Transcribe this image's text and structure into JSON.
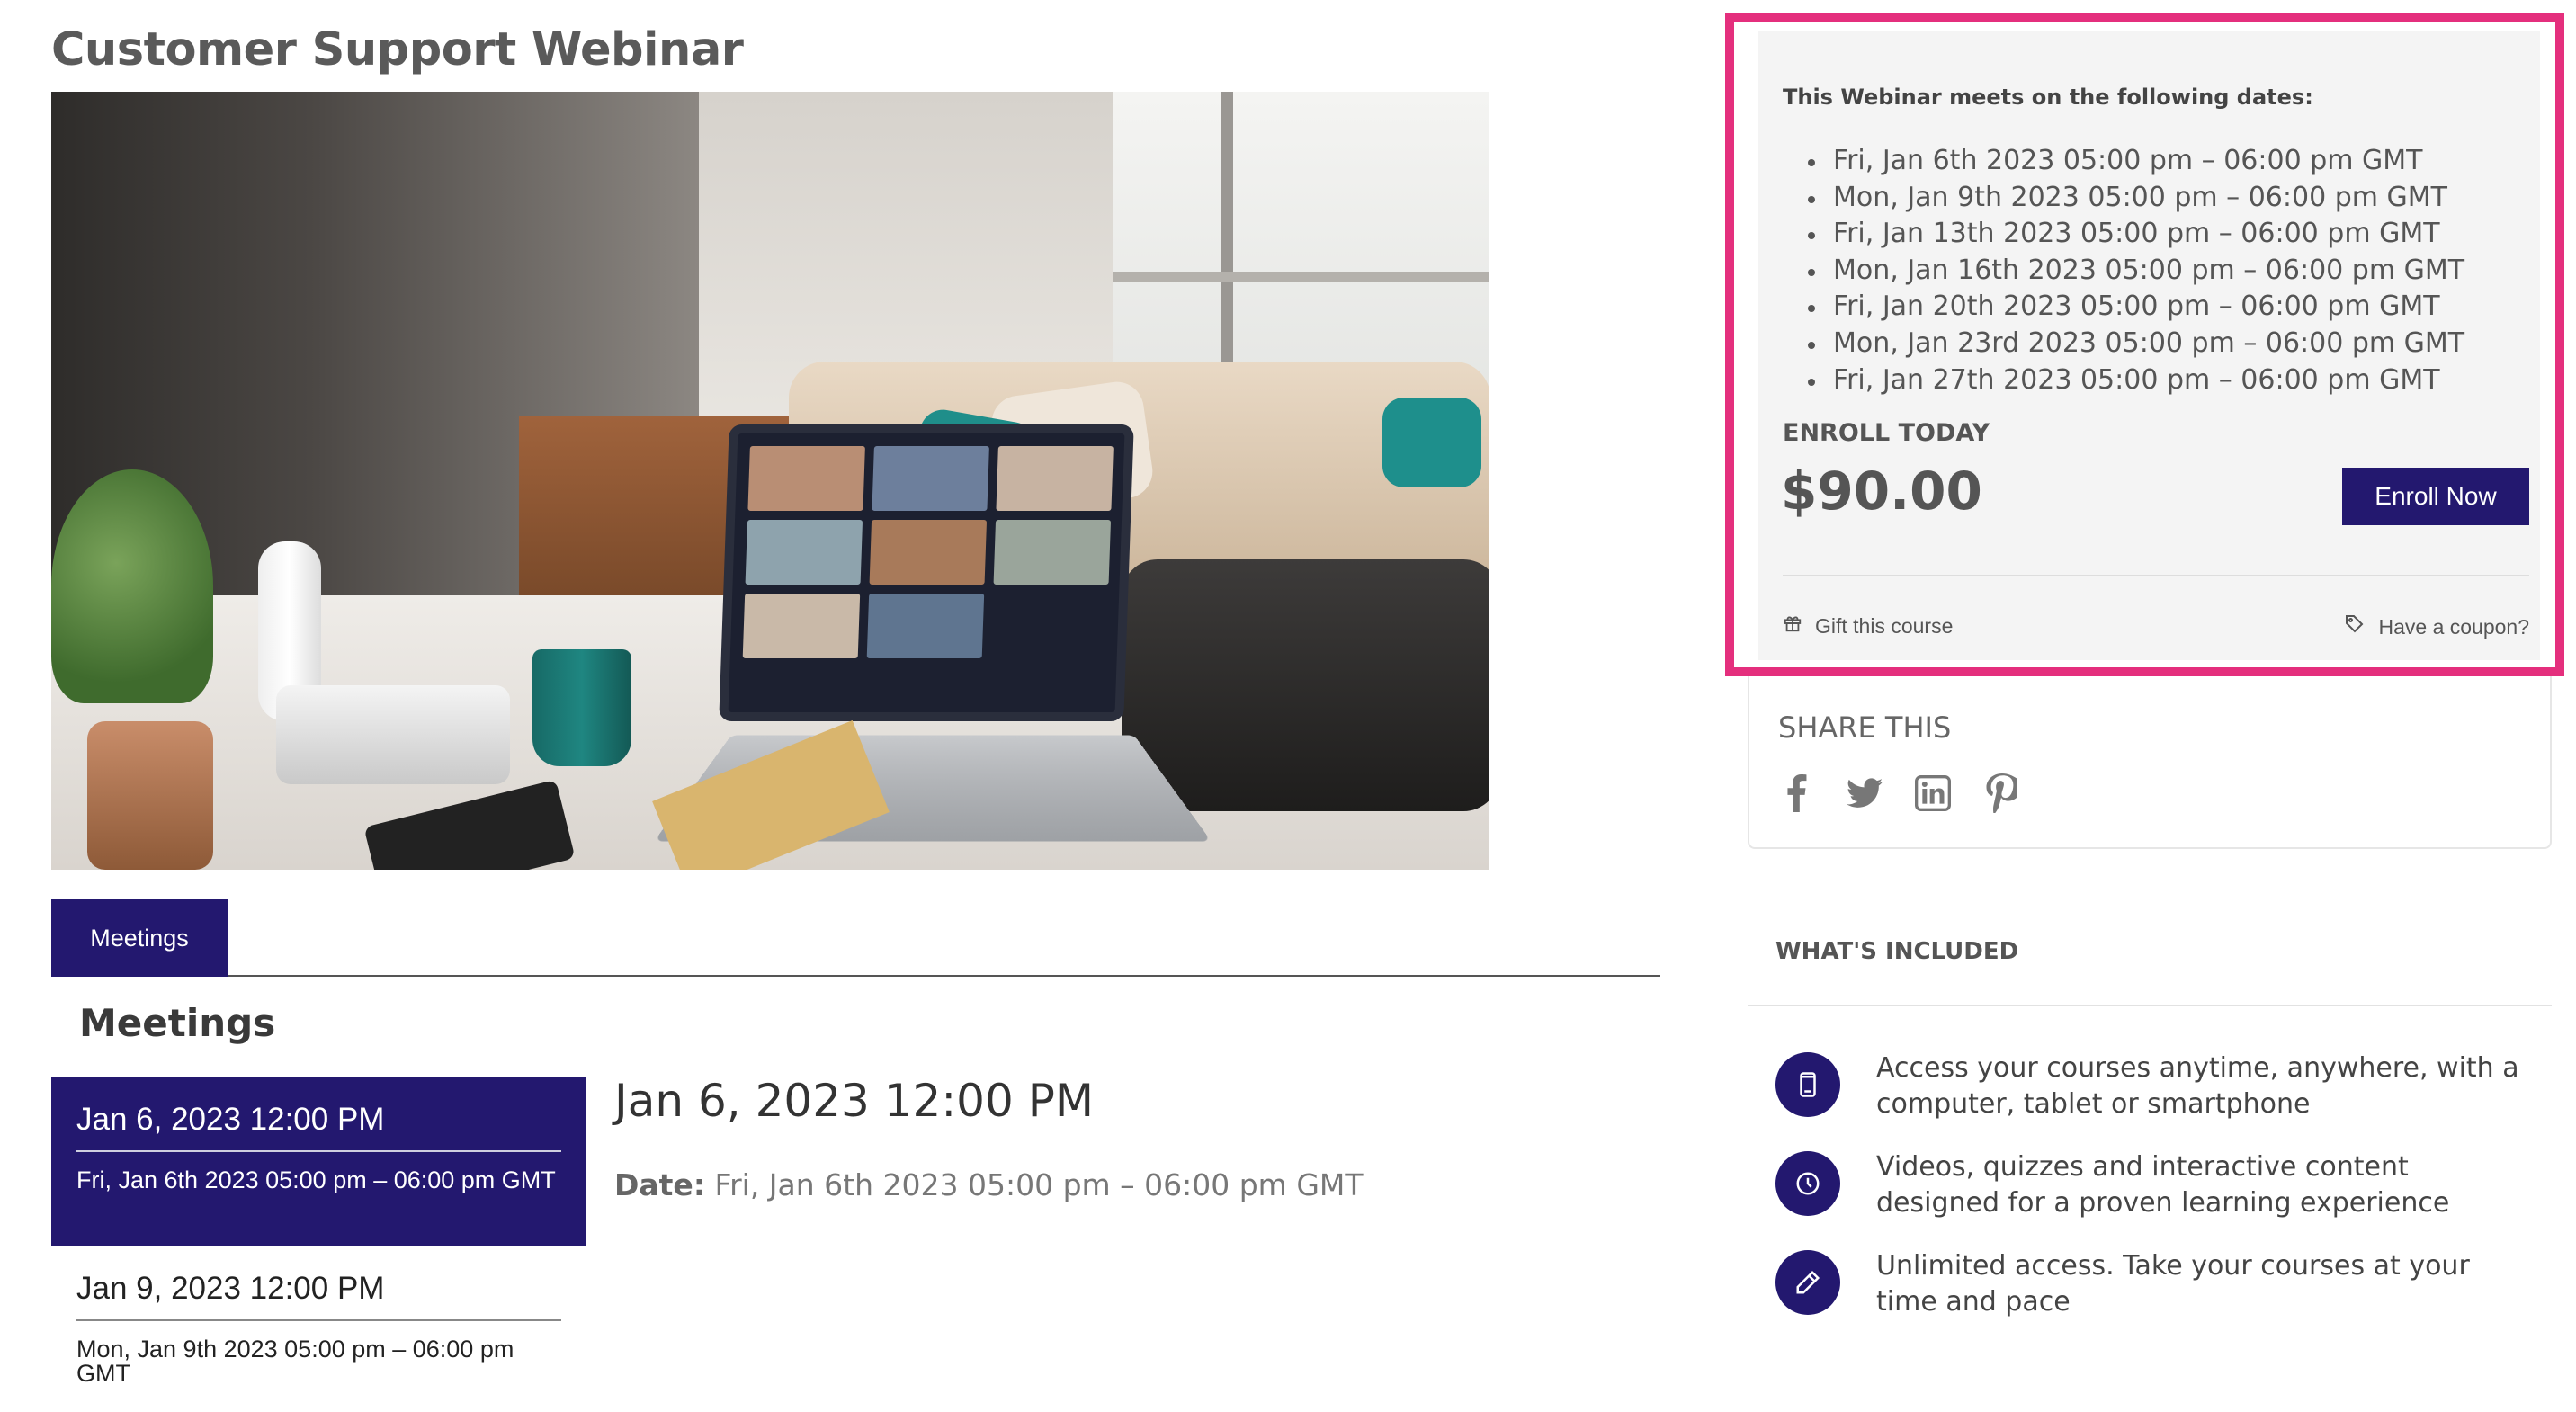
{
  "page": {
    "title": "Customer Support Webinar"
  },
  "tabs": [
    {
      "label": "Meetings"
    }
  ],
  "meetings_section": {
    "heading": "Meetings",
    "items": [
      {
        "title": "Jan 6, 2023 12:00 PM",
        "subtitle": "Fri, Jan 6th 2023 05:00 pm – 06:00 pm GMT",
        "active": true
      },
      {
        "title": "Jan 9, 2023 12:00 PM",
        "subtitle": "Mon, Jan 9th 2023 05:00 pm – 06:00 pm GMT",
        "active": false
      }
    ],
    "detail": {
      "title": "Jan 6, 2023 12:00 PM",
      "date_label": "Date:",
      "date_value": "Fri, Jan 6th 2023 05:00 pm – 06:00 pm GMT"
    }
  },
  "enroll": {
    "meets_label": "This Webinar meets on the following dates:",
    "dates": [
      "Fri, Jan 6th 2023 05:00 pm – 06:00 pm GMT",
      "Mon, Jan 9th 2023 05:00 pm – 06:00 pm GMT",
      "Fri, Jan 13th 2023 05:00 pm – 06:00 pm GMT",
      "Mon, Jan 16th 2023 05:00 pm – 06:00 pm GMT",
      "Fri, Jan 20th 2023 05:00 pm – 06:00 pm GMT",
      "Mon, Jan 23rd 2023 05:00 pm – 06:00 pm GMT",
      "Fri, Jan 27th 2023 05:00 pm – 06:00 pm GMT"
    ],
    "enroll_today": "ENROLL TODAY",
    "price": "$90.00",
    "button_label": "Enroll Now",
    "gift_label": "Gift this course",
    "coupon_label": "Have a coupon?"
  },
  "share": {
    "title": "SHARE THIS",
    "icons": [
      "facebook-icon",
      "twitter-icon",
      "linkedin-icon",
      "pinterest-icon"
    ]
  },
  "included": {
    "title": "WHAT'S INCLUDED",
    "items": [
      {
        "icon": "mobile-icon",
        "text": "Access your courses anytime, anywhere, with a computer, tablet or smartphone"
      },
      {
        "icon": "clock-icon",
        "text": "Videos, quizzes and interactive content designed for a proven learning experience"
      },
      {
        "icon": "pencil-icon",
        "text": "Unlimited access. Take your courses at your time and pace"
      }
    ]
  },
  "colors": {
    "primary": "#23186f",
    "highlight_border": "#e42f7d",
    "panel_bg": "#f4f4f4"
  }
}
